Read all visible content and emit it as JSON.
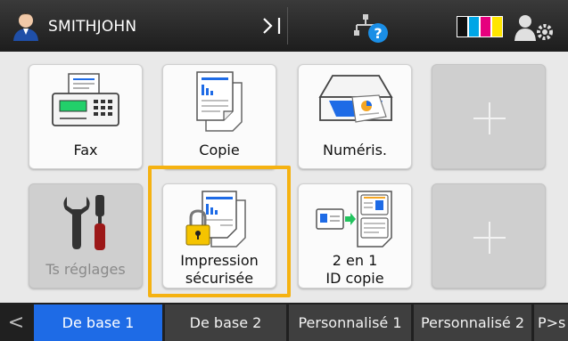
{
  "header": {
    "user_name": "SMITHJOHN",
    "logout_symbol": ">|",
    "toner_colors": [
      "#111111",
      "#00a6e6",
      "#e6007e",
      "#ffe500"
    ],
    "accent": "#1e6be6"
  },
  "tiles": {
    "fax": {
      "label": "Fax"
    },
    "copy": {
      "label": "Copie"
    },
    "scan": {
      "label": "Numéris."
    },
    "settings": {
      "label": "Ts réglages"
    },
    "secure_print_line1": "Impression",
    "secure_print_line2": "sécurisée",
    "id_copy_line1": "2 en 1",
    "id_copy_line2": "ID copie"
  },
  "tabs": {
    "prev_symbol": "<",
    "items": [
      {
        "label": "De base 1",
        "active": true
      },
      {
        "label": "De base 2",
        "active": false
      },
      {
        "label": "Personnalisé 1",
        "active": false
      },
      {
        "label": "Personnalisé 2",
        "active": false
      },
      {
        "label": "P>s",
        "active": false
      }
    ]
  }
}
